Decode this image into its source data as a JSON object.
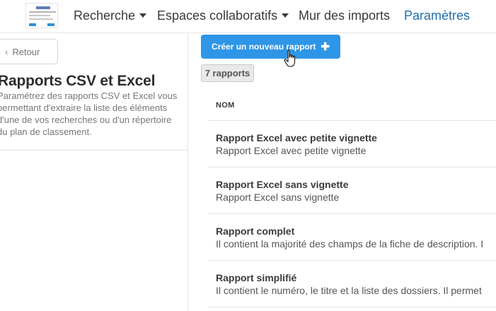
{
  "nav": {
    "items": [
      {
        "label": "Recherche"
      },
      {
        "label": "Espaces collaboratifs"
      },
      {
        "label": "Mur des imports"
      },
      {
        "label": "Paramètres"
      }
    ]
  },
  "sidebar": {
    "back_label": "Retour",
    "title": "Rapports CSV et Excel",
    "description": "Paramétrez des rapports CSV et Excel vous permettant d'extraire la liste des éléments d'une de vos recherches ou d'un répertoire du plan de classement."
  },
  "main": {
    "create_button_label": "Créer un nouveau rapport",
    "count_label": "7 rapports",
    "column_header": "NOM",
    "rows": [
      {
        "title": "Rapport Excel avec petite vignette",
        "desc": "Rapport Excel avec petite vignette"
      },
      {
        "title": "Rapport Excel sans vignette",
        "desc": "Rapport Excel sans vignette"
      },
      {
        "title": "Rapport complet",
        "desc": "Il contient la majorité des champs de la fiche de description. I"
      },
      {
        "title": "Rapport simplifié",
        "desc": "Il contient le numéro, le titre et la liste des dossiers. Il permet"
      }
    ]
  },
  "colors": {
    "accent": "#2e96e6",
    "active_nav": "#1f6fa8"
  },
  "icons": [
    "logo",
    "chevron-down-icon",
    "chevron-left-icon",
    "plus-icon",
    "hand-cursor-icon"
  ]
}
